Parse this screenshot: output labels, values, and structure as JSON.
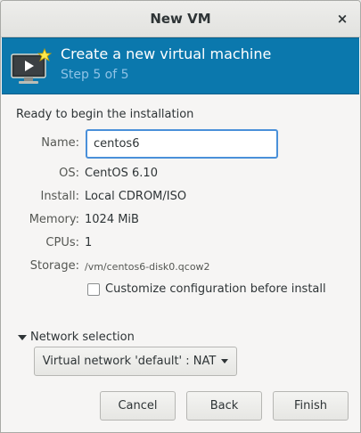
{
  "window": {
    "title": "New VM",
    "close_glyph": "×"
  },
  "header": {
    "title": "Create a new virtual machine",
    "step": "Step 5 of 5",
    "icon": "new-vm-icon",
    "bg_color": "#0b78ad"
  },
  "summary": {
    "ready_text": "Ready to begin the installation",
    "name_label": "Name:",
    "name_value": "centos6",
    "os_label": "OS:",
    "os_value": "CentOS 6.10",
    "install_label": "Install:",
    "install_value": "Local CDROM/ISO",
    "memory_label": "Memory:",
    "memory_value": "1024 MiB",
    "cpus_label": "CPUs:",
    "cpus_value": "1",
    "storage_label": "Storage:",
    "storage_value": "/vm/centos6-disk0.qcow2"
  },
  "customize": {
    "label": "Customize configuration before install",
    "checked": false
  },
  "network": {
    "expander_label": "Network selection",
    "selected": "Virtual network 'default' : NAT"
  },
  "buttons": {
    "cancel": "Cancel",
    "back": "Back",
    "finish": "Finish"
  }
}
